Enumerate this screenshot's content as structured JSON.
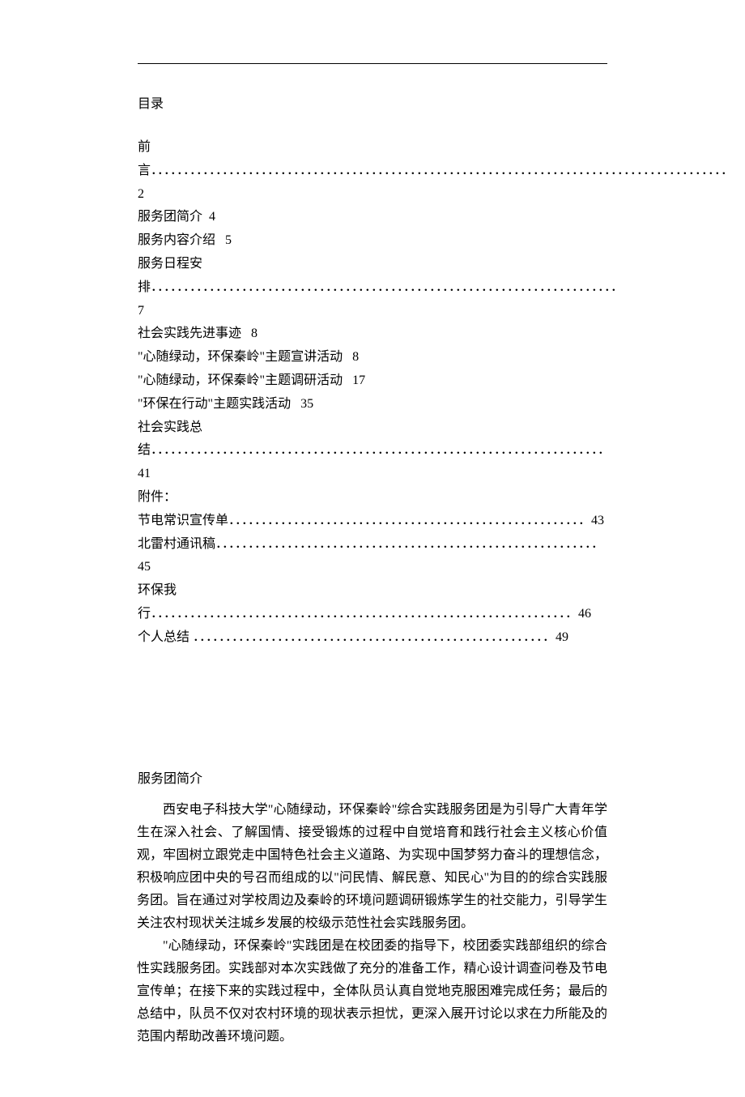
{
  "toc": {
    "title": "目录",
    "entries": [
      {
        "text": "前言",
        "dots": "．．．．．．．．．．．．．．．．．．．．．．．．．．．．．．．．．．．．．．．．．．．．．．．．．．．．．．．．．．．．．．．．．．．．．．．．．．．．．．．．．．．．．．．．．",
        "page": "2"
      },
      {
        "text": "服务团简介",
        "page": "4"
      },
      {
        "text": "服务内容介绍",
        "page": "5"
      },
      {
        "text": "服务日程安排",
        "dots": "．．．．．．．．．．．．．．．．．．．．．．．．．．．．．．．．．．．．．．．．．．．．．．．．．．．．．．．．．．．．．．．．．．．．．．．．",
        "page": "7"
      },
      {
        "text": "社会实践先进事迹",
        "page": "8"
      },
      {
        "text": " \"心随绿动，环保秦岭\"主题宣讲活动",
        "page": "8"
      },
      {
        "text": " \"心随绿动，环保秦岭\"主题调研活动",
        "page": "17"
      },
      {
        "text": " \"环保在行动\"主题实践活动",
        "page": "35"
      },
      {
        "text": "社会实践总结",
        "dots": "．．．．．．．．．．．．．．．．．．．．．．．．．．．．．．．．．．．．．．．．．．．．．．．．．．．．．．．．．．．．．．．．．．．．．．",
        "page": "41"
      },
      {
        "text": "附件：",
        "page": ""
      },
      {
        "text": "节电常识宣传单",
        "dots": "．．．．．．．．．．．．．．．．．．．．．．．．．．．．．．．．．．．．．．．．．．．．．．．．．．．．．．．",
        "page": "43"
      },
      {
        "text": "北雷村通讯稿",
        "dots": "．．．．．．．．．．．．．．．．．．．．．．．．．．．．．．．．．．．．．．．．．．．．．．．．．．．．．．．．．．．",
        "page": "45"
      },
      {
        "text": "环保我行",
        "dots": "．．．．．．．．．．．．．．．．．．．．．．．．．．．．．．．．．．．．．．．．．．．．．．．．．．．．．．．．．．．．．．．．．",
        "page": "46"
      },
      {
        "text": " 个人总结 ",
        "dots": "．．．．．．．．．．．．．．．．．．．．．．．．．．．．．．．．．．．．．．．．．．．．．．．．．．．．．．．",
        "page": "49"
      }
    ]
  },
  "section": {
    "title": "服务团简介",
    "para1": "西安电子科技大学\"心随绿动，环保秦岭\"综合实践服务团是为引导广大青年学生在深入社会、了解国情、接受锻炼的过程中自觉培育和践行社会主义核心价值观，牢固树立跟党走中国特色社会主义道路、为实现中国梦努力奋斗的理想信念，积极响应团中央的号召而组成的以\"问民情、解民意、知民心\"为目的的综合实践服务团。旨在通过对学校周边及秦岭的环境问题调研锻炼学生的社交能力，引导学生关注农村现状关注城乡发展的校级示范性社会实践服务团。",
    "para2": "\"心随绿动，环保秦岭\"实践团是在校团委的指导下，校团委实践部组织的综合性实践服务团。实践部对本次实践做了充分的准备工作，精心设计调查问卷及节电宣传单；在接下来的实践过程中，全体队员认真自觉地克服困难完成任务；最后的总结中，队员不仅对农村环境的现状表示担忧，更深入展开讨论以求在力所能及的范围内帮助改善环境问题。"
  }
}
